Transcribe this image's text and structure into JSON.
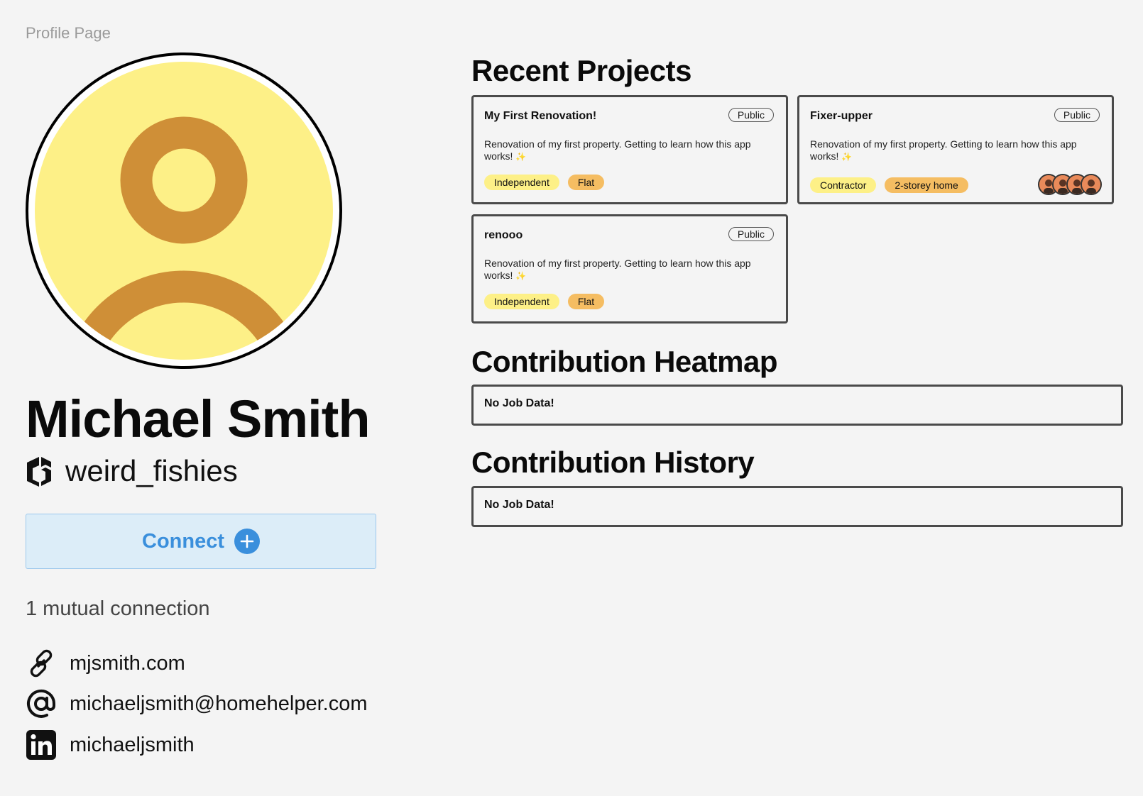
{
  "page": {
    "label": "Profile Page"
  },
  "profile": {
    "name": "Michael Smith",
    "handle": "weird_fishies",
    "connect_label": "Connect",
    "mutual": "1 mutual connection",
    "website": "mjsmith.com",
    "email": "michaeljsmith@homehelper.com",
    "linkedin": "michaeljsmith"
  },
  "sections": {
    "projects_title": "Recent Projects",
    "heatmap_title": "Contribution Heatmap",
    "history_title": "Contribution History",
    "heatmap_empty": "No Job Data!",
    "history_empty": "No Job Data!"
  },
  "projects": [
    {
      "title": "My First Renovation!",
      "visibility": "Public",
      "description": "Renovation of my first property. Getting to learn how this app works!",
      "tags": [
        "Independent",
        "Flat"
      ]
    },
    {
      "title": "Fixer-upper",
      "visibility": "Public",
      "description": "Renovation of my first property. Getting to learn how this app works!",
      "tags": [
        "Contractor",
        "2-storey home"
      ]
    },
    {
      "title": "renooo",
      "visibility": "Public",
      "description": "Renovation of my first property. Getting to learn how this app works!",
      "tags": [
        "Independent",
        "Flat"
      ]
    }
  ],
  "colors": {
    "avatar_bg": "#fdf087",
    "avatar_fg": "#cf8f37",
    "connect_accent": "#3a8fdc",
    "tag_yellow": "#fdf087",
    "tag_orange": "#f5bd62"
  },
  "icons": [
    "user-avatar-icon",
    "handle-logo-icon",
    "plus-icon",
    "link-icon",
    "at-icon",
    "linkedin-icon",
    "sparkle-icon"
  ]
}
